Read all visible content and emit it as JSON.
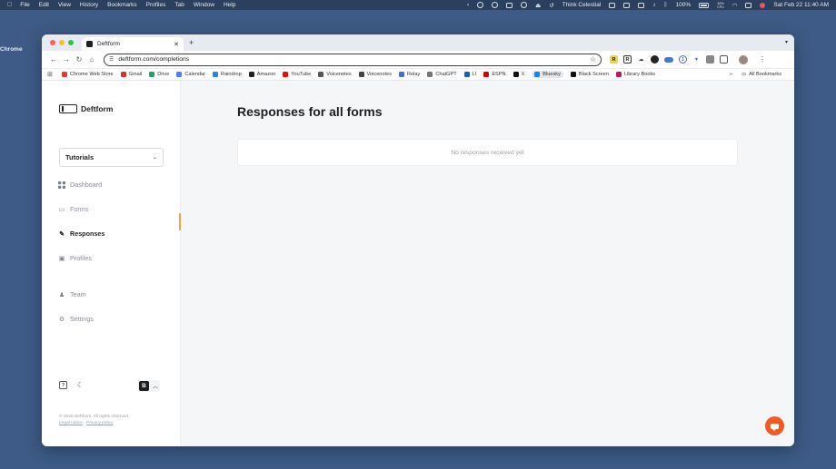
{
  "menubar": {
    "app_name": "Chrome",
    "items": [
      "File",
      "Edit",
      "View",
      "History",
      "Bookmarks",
      "Profiles",
      "Tab",
      "Window",
      "Help"
    ],
    "now_playing": "Think Celestial",
    "battery": "100%",
    "cpu_top": "45%",
    "cpu_bottom": "CPU",
    "datetime": "Sat Feb 22  11:40 AM"
  },
  "browser": {
    "tab_title": "Deftform",
    "url": "deftform.com/completions",
    "bookmarks": [
      "Chrome Web Store",
      "Gmail",
      "Drive",
      "Calendar",
      "Raindrop",
      "Amazon",
      "YouTube",
      "Voicenotes",
      "Voicenotes",
      "Relay",
      "ChatGPT",
      "LI",
      "ESPN",
      "X",
      "Bluesky",
      "Black Screen",
      "Library Books"
    ],
    "bookmark_colors": [
      "#e53935",
      "#d93025",
      "#1fa463",
      "#4285f4",
      "#1e88e5",
      "#222222",
      "#ff0000",
      "#555555",
      "#444444",
      "#4169e1",
      "#777777",
      "#0a66c2",
      "#d50000",
      "#111111",
      "#1185fe",
      "#111111",
      "#c2185b"
    ],
    "all_bookmarks": "All Bookmarks",
    "overflow": "»"
  },
  "sidebar": {
    "brand": "Deftform",
    "team": "Tutorials",
    "nav": [
      {
        "label": "Dashboard",
        "icon": "grid-icon"
      },
      {
        "label": "Forms",
        "icon": "form-icon"
      },
      {
        "label": "Responses",
        "icon": "pen-icon",
        "active": true
      },
      {
        "label": "Profiles",
        "icon": "briefcase-icon"
      },
      {
        "label": "Team",
        "icon": "team-icon"
      },
      {
        "label": "Settings",
        "icon": "gear-icon"
      }
    ],
    "workspace_badge": "B",
    "copyright": "© 2025 Deftform. All rights reserved.",
    "legal_notice": "Legal notice",
    "separator": " · ",
    "privacy_policy": "Privacy policy"
  },
  "main": {
    "title": "Responses for all forms",
    "empty_message": "No responses received yet"
  }
}
